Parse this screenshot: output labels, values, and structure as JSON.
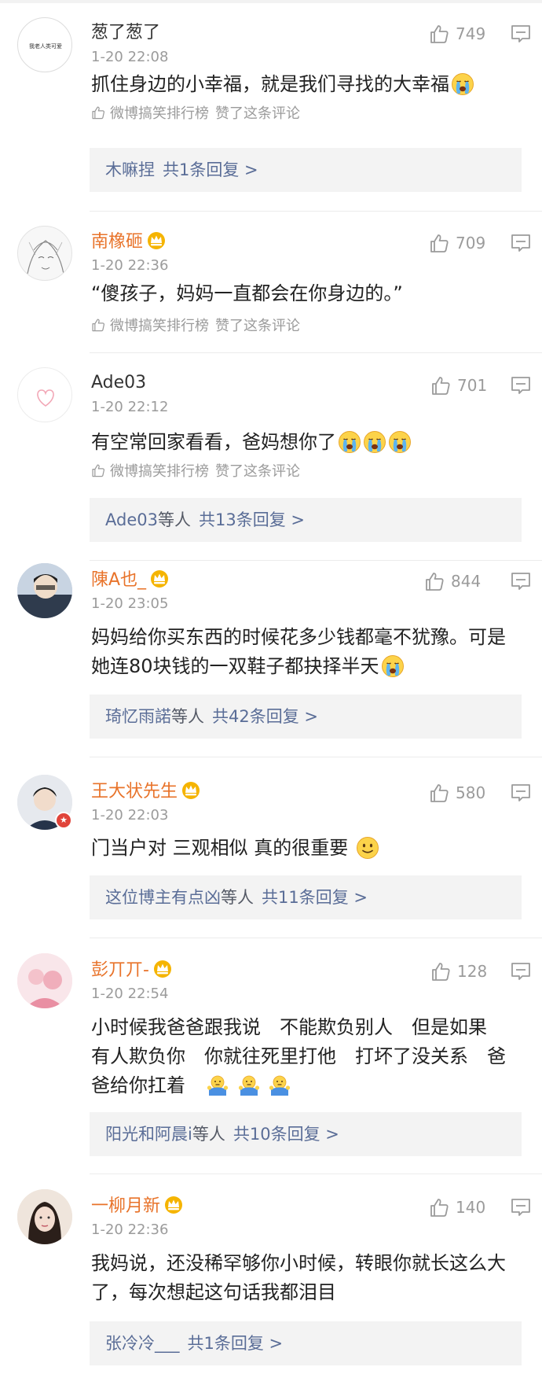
{
  "comments": [
    {
      "name": "葱了葱了",
      "time": "1-20 22:08",
      "likes": "749",
      "text": "抓住身边的小幸福，就是我们寻找的大幸福",
      "liked_by": "微博搞笑排行榜",
      "liked_suffix": "赞了这条评论",
      "reply_who": "木嘛捏",
      "reply_etc": "",
      "reply_total": "共1条回复 >",
      "avatar_text": "我老人类可爱"
    },
    {
      "name": "南橡砸",
      "time": "1-20 22:36",
      "likes": "709",
      "text": "“傻孩子，妈妈一直都会在你身边的。”",
      "liked_by": "微博搞笑排行榜",
      "liked_suffix": "赞了这条评论"
    },
    {
      "name": "Ade03",
      "time": "1-20 22:12",
      "likes": "701",
      "text": "有空常回家看看，爸妈想你了",
      "liked_by": "微博搞笑排行榜",
      "liked_suffix": "赞了这条评论",
      "reply_who": "Ade03",
      "reply_etc": "等人",
      "reply_total": "共13条回复 >"
    },
    {
      "name": "陳A也_",
      "time": "1-20 23:05",
      "likes": "844",
      "text_line1": "妈妈给你买东西的时候花多少钱都毫不犹豫。可是",
      "text_line2": "她连80块钱的一双鞋子都抉择半天",
      "reply_who": "琦忆雨諾",
      "reply_etc": "等人",
      "reply_total": "共42条回复 >"
    },
    {
      "name": "王大状先生",
      "time": "1-20 22:03",
      "likes": "580",
      "text": "门当户对 三观相似 真的很重要",
      "reply_who": "这位博主有点凶",
      "reply_etc": "等人",
      "reply_total": "共11条回复 >"
    },
    {
      "name": "彭丌丌-",
      "time": "1-20 22:54",
      "likes": "128",
      "text_line1": "小时候我爸爸跟我说　不能欺负别人　但是如果",
      "text_line2": "有人欺负你　你就往死里打他　打坏了没关系　爸",
      "text_line3": "爸给你扛着",
      "reply_who": "阳光和阿晨i",
      "reply_etc": "等人",
      "reply_total": "共10条回复 >"
    },
    {
      "name": "一柳月新",
      "time": "1-20 22:36",
      "likes": "140",
      "text_line1": "我妈说，还没稀罕够你小时候，转眼你就长这么大",
      "text_line2": "了，每次想起这句话我都泪目",
      "reply_who": "张冷冷___",
      "reply_etc": "",
      "reply_total": "共1条回复 >"
    }
  ],
  "colors": {
    "vip_name": "#e8732a",
    "link_blue": "#5a6d97",
    "meta_gray": "#9b9b9b",
    "reply_bg": "#f3f3f3",
    "crown_gold": "#f5b400",
    "badge_red": "#e0443a"
  },
  "icons": {
    "like": "thumbs-up-icon",
    "reply": "comment-bubble-icon",
    "crown": "vip-crown-icon",
    "cry": "crying-face-emoji",
    "smile": "smile-emoji",
    "shrug": "shrug-emoji"
  }
}
